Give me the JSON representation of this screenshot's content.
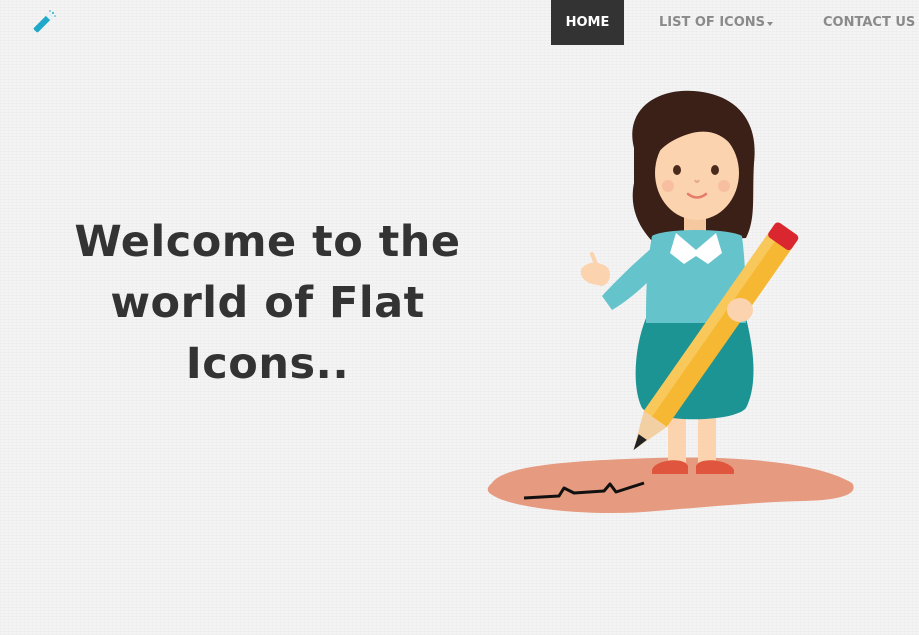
{
  "nav": {
    "logo_icon": "magic-wand-icon",
    "items": [
      {
        "label": "HOME",
        "active": true
      },
      {
        "label": "LIST OF ICONS",
        "has_dropdown": true
      },
      {
        "label": "CONTACT US"
      }
    ]
  },
  "hero": {
    "title": "Welcome to the world of Flat Icons.."
  },
  "illustration": {
    "name": "girl-with-pencil"
  },
  "colors": {
    "active_nav_bg": "#333333",
    "nav_text": "#8a8a8a",
    "title_text": "#333333",
    "accent": "#1fa8c9"
  }
}
